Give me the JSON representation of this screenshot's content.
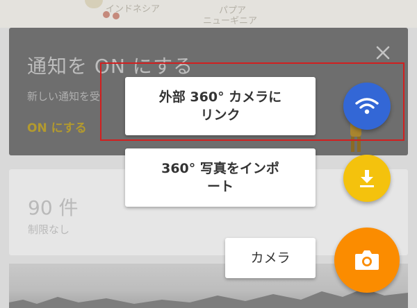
{
  "map": {
    "label_indonesia": "インドネシア",
    "label_papua_line1": "パプア",
    "label_papua_line2": "ニューギニア"
  },
  "notification_card": {
    "title": "通知を ON にする",
    "body": "新しい通知を受",
    "action": "ON にする",
    "close_icon": "close-icon"
  },
  "count_card": {
    "value": "90 件",
    "subtitle": "制限なし"
  },
  "speed_dial": {
    "link_360_camera_label": "外部 360° カメラに\nリンク",
    "import_360_photo_label": "360° 写真をインポ\nート",
    "camera_label": "カメラ"
  },
  "fab_icons": {
    "wifi": "wifi-icon",
    "download": "download-icon",
    "camera": "camera-icon"
  },
  "colors": {
    "fab_blue": "#3367d6",
    "fab_yellow": "#f4c20d",
    "fab_orange": "#fb8c00",
    "highlight_red": "#d21f1f",
    "scrim_card": "#6e6e6e"
  }
}
